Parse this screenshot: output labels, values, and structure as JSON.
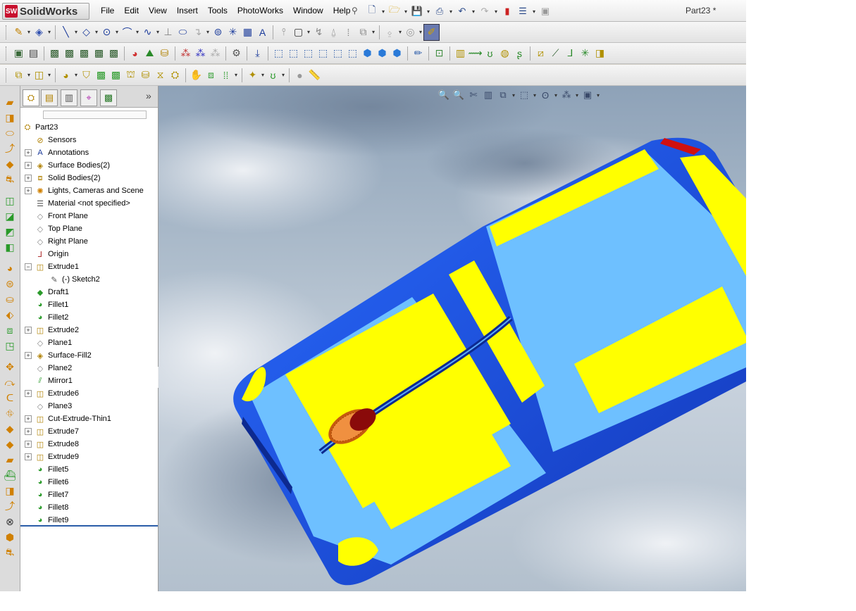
{
  "app": {
    "logo_badge": "SW",
    "logo_text": "SolidWorks",
    "document_title": "Part23 *"
  },
  "menu": [
    "File",
    "Edit",
    "View",
    "Insert",
    "Tools",
    "PhotoWorks",
    "Window",
    "Help"
  ],
  "feature_tree": {
    "root": "Part23",
    "items": [
      {
        "label": "Sensors",
        "icon": "sensors-icon",
        "expandable": false
      },
      {
        "label": "Annotations",
        "icon": "annotations-icon",
        "expandable": true
      },
      {
        "label": "Surface Bodies(2)",
        "icon": "surface-bodies-icon",
        "expandable": true
      },
      {
        "label": "Solid Bodies(2)",
        "icon": "solid-bodies-icon",
        "expandable": true
      },
      {
        "label": "Lights, Cameras and Scene",
        "icon": "lights-icon",
        "expandable": true
      },
      {
        "label": "Material <not specified>",
        "icon": "material-icon",
        "expandable": false
      },
      {
        "label": "Front Plane",
        "icon": "plane-icon",
        "expandable": false
      },
      {
        "label": "Top Plane",
        "icon": "plane-icon",
        "expandable": false
      },
      {
        "label": "Right Plane",
        "icon": "plane-icon",
        "expandable": false
      },
      {
        "label": "Origin",
        "icon": "origin-icon",
        "expandable": false
      },
      {
        "label": "Extrude1",
        "icon": "extrude-icon",
        "expandable": true,
        "expanded": true
      },
      {
        "label": "(-) Sketch2",
        "icon": "sketch-icon",
        "expandable": false,
        "child": true
      },
      {
        "label": "Draft1",
        "icon": "draft-icon",
        "expandable": false
      },
      {
        "label": "Fillet1",
        "icon": "fillet-icon",
        "expandable": false
      },
      {
        "label": "Fillet2",
        "icon": "fillet-icon",
        "expandable": false
      },
      {
        "label": "Extrude2",
        "icon": "extrude-icon",
        "expandable": true
      },
      {
        "label": "Plane1",
        "icon": "plane-icon",
        "expandable": false
      },
      {
        "label": "Surface-Fill2",
        "icon": "surface-fill-icon",
        "expandable": true
      },
      {
        "label": "Plane2",
        "icon": "plane-icon",
        "expandable": false
      },
      {
        "label": "Mirror1",
        "icon": "mirror-icon",
        "expandable": false
      },
      {
        "label": "Extrude6",
        "icon": "extrude-icon",
        "expandable": true
      },
      {
        "label": "Plane3",
        "icon": "plane-icon",
        "expandable": false
      },
      {
        "label": "Cut-Extrude-Thin1",
        "icon": "cut-extrude-icon",
        "expandable": true
      },
      {
        "label": "Extrude7",
        "icon": "extrude-icon",
        "expandable": true
      },
      {
        "label": "Extrude8",
        "icon": "extrude-icon",
        "expandable": true
      },
      {
        "label": "Extrude9",
        "icon": "extrude-icon",
        "expandable": true
      },
      {
        "label": "Fillet5",
        "icon": "fillet-icon",
        "expandable": false
      },
      {
        "label": "Fillet6",
        "icon": "fillet-icon",
        "expandable": false
      },
      {
        "label": "Fillet7",
        "icon": "fillet-icon",
        "expandable": false
      },
      {
        "label": "Fillet8",
        "icon": "fillet-icon",
        "expandable": false
      },
      {
        "label": "Fillet9",
        "icon": "fillet-icon",
        "expandable": false
      }
    ]
  },
  "colors": {
    "model_blue": "#1f4fe0",
    "model_light_blue": "#79c4ff",
    "model_yellow": "#ffff00",
    "wheel_orange": "#e07a2a",
    "rollback_bar": "#2a5da8"
  }
}
